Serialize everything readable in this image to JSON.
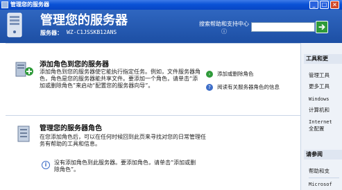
{
  "window": {
    "title": "管理您的服务器",
    "buttons": {
      "minimize": "_",
      "maximize": "□",
      "close": "×"
    }
  },
  "header": {
    "title": "管理您的服务器",
    "server_label": "服务器：",
    "server_name": "WZ-C1JSSKB12ANS",
    "search_label": "搜索帮助和支持中心 ⓘ",
    "search_value": "",
    "search_icon": "green-arrow-go-icon"
  },
  "sections": [
    {
      "icon": "server-roles-icon",
      "title": "添加角色到您的服务器",
      "description": "添加角色到您的服务器使它能执行指定任务。例如，文件服务器角色，角色是您的服务器能共享文件。要添加一个角色，请单击“添加或删除角色”来启动“配置您的服务器向导”。",
      "links": [
        {
          "icon": "green-arrow-icon",
          "label": "添加或删除角色"
        },
        {
          "icon": "help-icon",
          "label": "阅读有关服务器角色的信息"
        }
      ]
    },
    {
      "icon": "manage-roles-icon",
      "title": "管理您的服务器角色",
      "description": "在您添加角色后，可以在任何时候回到此页来寻找对您的日常管理任务有帮助的工具和信息。",
      "info": "没有添加角色到此服务器。要添加角色，请单击“添加或删除角色”。"
    }
  ],
  "right_panel": {
    "tools_header": "工具和更",
    "tools_items": [
      "管理工具",
      "更多工具",
      "Windows",
      "计算机和",
      "Internet",
      "全配置"
    ],
    "see_also_header": "请参阅",
    "see_also_items": [
      "帮助和支",
      "Microsof"
    ]
  },
  "colors": {
    "titlebar": "#0a52d6",
    "header": "#1d4fa4",
    "go_green": "#2f9a3a",
    "panel_bg": "#eef2f8"
  }
}
